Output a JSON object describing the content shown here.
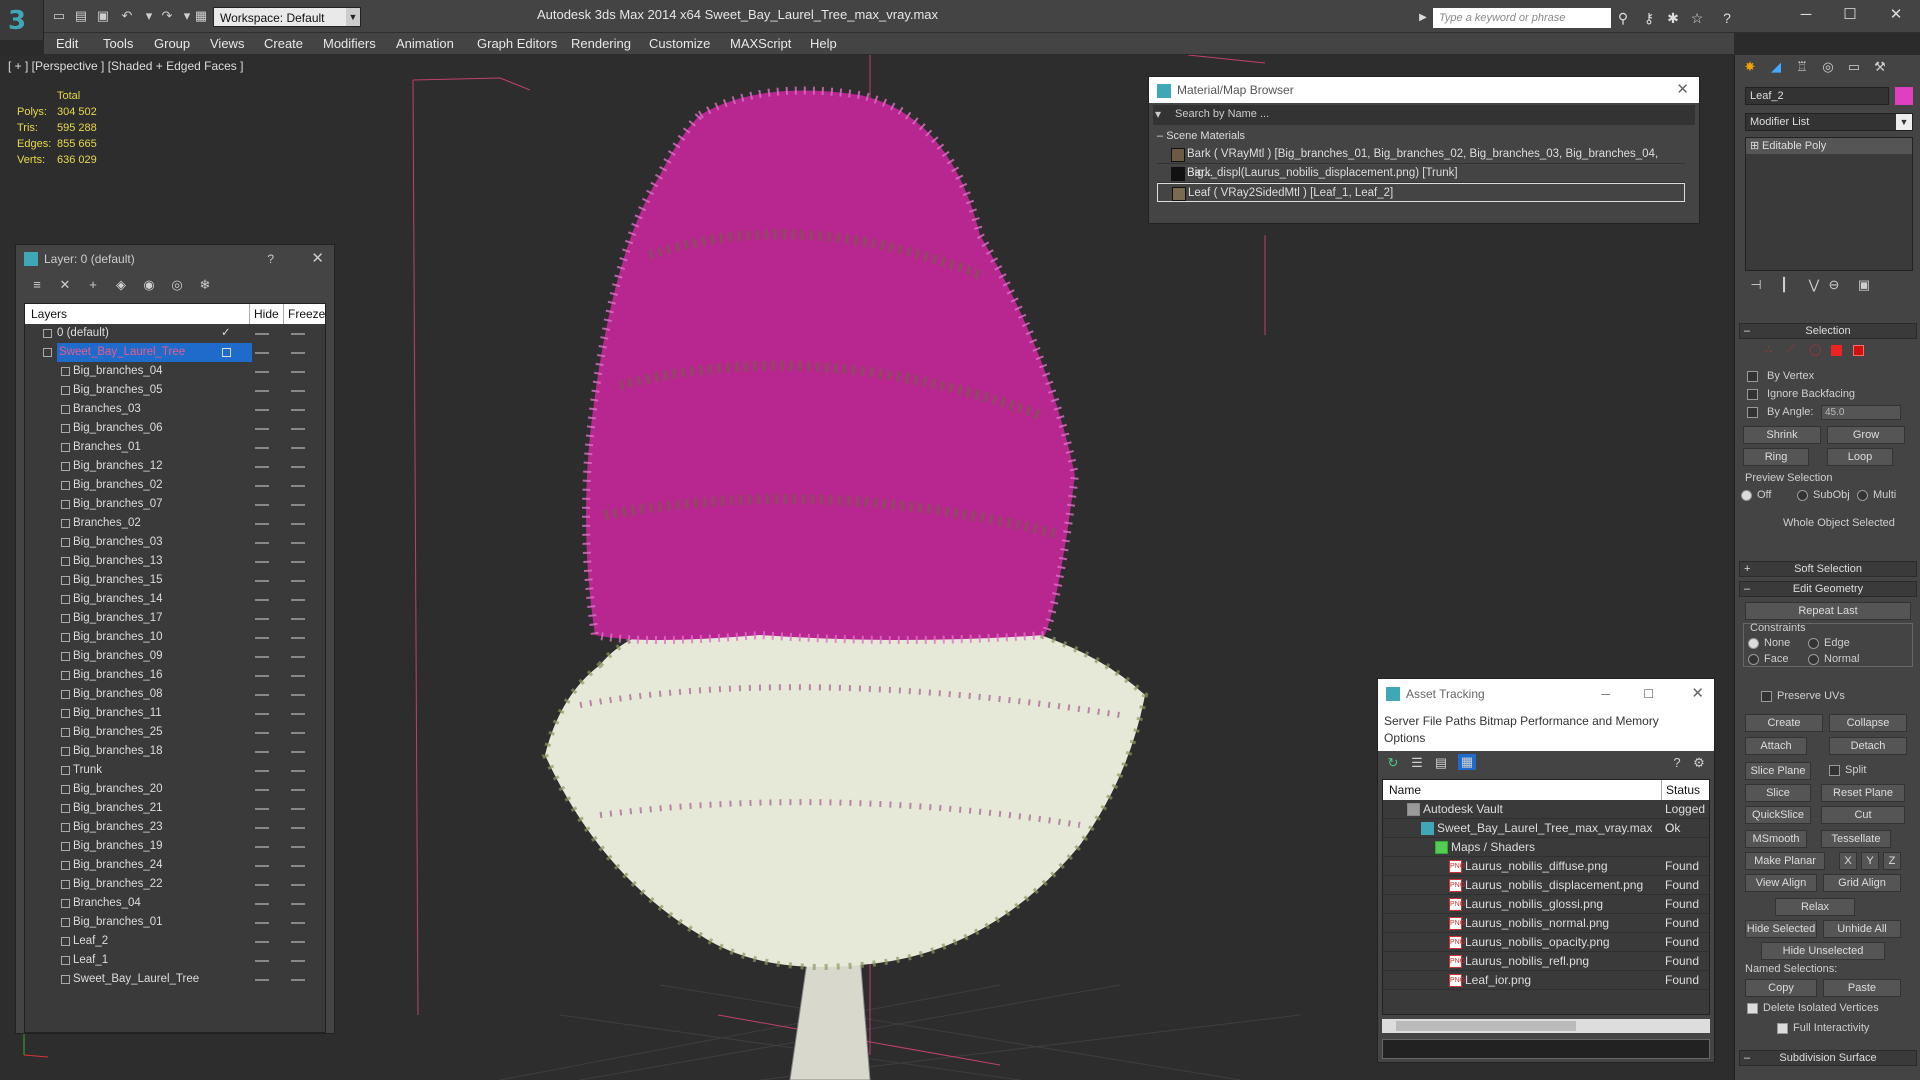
{
  "app": {
    "title": "Autodesk 3ds Max  2014 x64",
    "file": "Sweet_Bay_Laurel_Tree_max_vray.max",
    "workspace": "Workspace: Default",
    "search_placeholder": "Type a keyword or phrase"
  },
  "menu": [
    "Edit",
    "Tools",
    "Group",
    "Views",
    "Create",
    "Modifiers",
    "Animation",
    "Graph Editors",
    "Rendering",
    "Customize",
    "MAXScript",
    "Help"
  ],
  "viewport": {
    "label": "[ + ] [Perspective ] [Shaded + Edged Faces ]",
    "stats": {
      "header": "Total",
      "rows": [
        {
          "k": "Polys:",
          "v": "304 502"
        },
        {
          "k": "Tris:",
          "v": "595 288"
        },
        {
          "k": "Edges:",
          "v": "855 665"
        },
        {
          "k": "Verts:",
          "v": "636 029"
        }
      ]
    }
  },
  "layers": {
    "title": "Layer: 0 (default)",
    "help": "?",
    "columns": {
      "name": "Layers",
      "hide": "Hide",
      "freeze": "Freeze"
    },
    "items": [
      "0 (default)",
      "Sweet_Bay_Laurel_Tree",
      "Big_branches_04",
      "Big_branches_05",
      "Branches_03",
      "Big_branches_06",
      "Branches_01",
      "Big_branches_12",
      "Big_branches_02",
      "Big_branches_07",
      "Branches_02",
      "Big_branches_03",
      "Big_branches_13",
      "Big_branches_15",
      "Big_branches_14",
      "Big_branches_17",
      "Big_branches_10",
      "Big_branches_09",
      "Big_branches_16",
      "Big_branches_08",
      "Big_branches_11",
      "Big_branches_25",
      "Big_branches_18",
      "Trunk",
      "Big_branches_20",
      "Big_branches_21",
      "Big_branches_23",
      "Big_branches_19",
      "Big_branches_24",
      "Big_branches_22",
      "Branches_04",
      "Big_branches_01",
      "Leaf_2",
      "Leaf_1",
      "Sweet_Bay_Laurel_Tree"
    ]
  },
  "material_browser": {
    "title": "Material/Map Browser",
    "search": "Search by Name ...",
    "section": "Scene Materials",
    "items": [
      {
        "text": "Bark  ( VRayMtl ) [Big_branches_01, Big_branches_02, Big_branches_03, Big_branches_04, Big...",
        "color": "#6b5a44"
      },
      {
        "text": "Bark_displ(Laurus_nobilis_displacement.png) [Trunk]",
        "color": "#111111"
      },
      {
        "text": "Leaf  ( VRay2SidedMtl ) [Leaf_1, Leaf_2]",
        "color": "#7a6a50"
      }
    ]
  },
  "asset_tracking": {
    "title": "Asset Tracking",
    "menu": [
      "Server",
      "File",
      "Paths",
      "Bitmap Performance and Memory",
      "Options"
    ],
    "columns": {
      "name": "Name",
      "status": "Status"
    },
    "rows": [
      {
        "name": "Autodesk Vault",
        "status": "Logged O",
        "indent": 1,
        "icon": "vault"
      },
      {
        "name": "Sweet_Bay_Laurel_Tree_max_vray.max",
        "status": "Ok",
        "indent": 2,
        "icon": "max"
      },
      {
        "name": "Maps / Shaders",
        "status": "",
        "indent": 3,
        "icon": "folder"
      },
      {
        "name": "Laurus_nobilis_diffuse.png",
        "status": "Found",
        "indent": 4,
        "icon": "png"
      },
      {
        "name": "Laurus_nobilis_displacement.png",
        "status": "Found",
        "indent": 4,
        "icon": "png"
      },
      {
        "name": "Laurus_nobilis_glossi.png",
        "status": "Found",
        "indent": 4,
        "icon": "png"
      },
      {
        "name": "Laurus_nobilis_normal.png",
        "status": "Found",
        "indent": 4,
        "icon": "png"
      },
      {
        "name": "Laurus_nobilis_opacity.png",
        "status": "Found",
        "indent": 4,
        "icon": "png"
      },
      {
        "name": "Laurus_nobilis_refl.png",
        "status": "Found",
        "indent": 4,
        "icon": "png"
      },
      {
        "name": "Leaf_ior.png",
        "status": "Found",
        "indent": 4,
        "icon": "png"
      }
    ],
    "png_badge": "PNG"
  },
  "command_panel": {
    "object_name": "Leaf_2",
    "object_color": "#e040c0",
    "modifier_list": "Modifier List",
    "stack_item": "Editable Poly",
    "selection": {
      "title": "Selection",
      "by_vertex": "By Vertex",
      "ignore_backfacing": "Ignore Backfacing",
      "by_angle": "By Angle:",
      "angle": "45.0",
      "shrink": "Shrink",
      "grow": "Grow",
      "ring": "Ring",
      "loop": "Loop",
      "preview": "Preview Selection",
      "off": "Off",
      "subobj": "SubObj",
      "multi": "Multi",
      "status": "Whole Object Selected"
    },
    "soft_selection": "Soft Selection",
    "edit_geometry": {
      "title": "Edit Geometry",
      "repeat_last": "Repeat Last",
      "constraints": "Constraints",
      "none": "None",
      "edge": "Edge",
      "face": "Face",
      "normal": "Normal",
      "preserve_uvs": "Preserve UVs",
      "create": "Create",
      "collapse": "Collapse",
      "attach": "Attach",
      "detach": "Detach",
      "slice_plane": "Slice Plane",
      "split": "Split",
      "slice": "Slice",
      "reset_plane": "Reset Plane",
      "quickslice": "QuickSlice",
      "cut": "Cut",
      "msmooth": "MSmooth",
      "tessellate": "Tessellate",
      "make_planar": "Make Planar",
      "x": "X",
      "y": "Y",
      "z": "Z",
      "view_align": "View Align",
      "grid_align": "Grid Align",
      "relax": "Relax",
      "hide_selected": "Hide Selected",
      "unhide_all": "Unhide All",
      "hide_unselected": "Hide Unselected",
      "named_selections": "Named Selections:",
      "copy": "Copy",
      "paste": "Paste",
      "delete_isolated": "Delete Isolated Vertices",
      "full_interactivity": "Full Interactivity"
    },
    "subdivision_surface": "Subdivision Surface"
  }
}
